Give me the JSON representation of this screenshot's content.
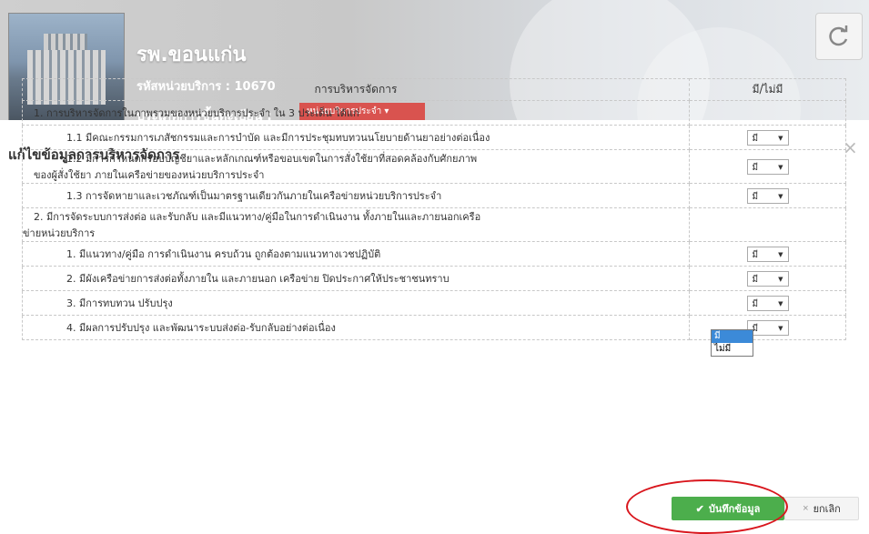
{
  "header": {
    "hospital_name": "รพ.ขอนแก่น",
    "code_label": "รหัสหน่วยบริการ : 10670",
    "type_label": "ประเภทการขึ้นทะเบียน :",
    "type_value": "หน่วยบริการประจำ ▾"
  },
  "modal": {
    "title": "แก้ไขข้อมูลการบริหารจัดการ",
    "close_label": "×"
  },
  "table": {
    "col_item": "การบริหารจัดการ",
    "col_status": "มี/ไม่มี",
    "rows": [
      {
        "text": "1. การบริหารจัดการในภาพรวมของหน่วยบริการประจำ ใน 3 ประเด็น ได้แก่",
        "value": ""
      },
      {
        "text": "1.1 มีคณะกรรมการเภสัชกรรมและการบำบัด และมีการประชุมทบทวนนโยบายด้านยาอย่างต่อเนื่อง",
        "value": "มี"
      },
      {
        "text": "1.2 มีการกำหนดกรอบบัญชียาและหลักเกณฑ์หรือขอบเขตในการสั่งใช้ยาที่สอดคล้องกับศักยภาพ",
        "text2": "ของผู้สั่งใช้ยา ภายในเครือข่ายของหน่วยบริการประจำ",
        "value": "มี"
      },
      {
        "text": "1.3 การจัดหายาและเวชภัณฑ์เป็นมาตรฐานเดียวกันภายในเครือข่ายหน่วยบริการประจำ",
        "value": "มี"
      },
      {
        "text": "2. มีการจัดระบบการส่งต่อ และรับกลับ และมีแนวทาง/คู่มือในการดำเนินงาน ทั้งภายในและภายนอกเครือ",
        "text2": "ข่ายหน่วยบริการ",
        "value": ""
      },
      {
        "text": "1. มีแนวทาง/คู่มือ การดำเนินงาน ครบถ้วน ถูกต้องตามแนวทางเวชปฏิบัติ",
        "value": "มี"
      },
      {
        "text": "2. มีผังเครือข่ายการส่งต่อทั้งภายใน และภายนอก เครือข่าย ปิดประกาศให้ประชาชนทราบ",
        "value": "มี"
      },
      {
        "text": "3. มีการทบทวน ปรับปรุง",
        "value": "มี"
      },
      {
        "text": "4. มีผลการปรับปรุง และพัฒนาระบบส่งต่อ-รับกลับอย่างต่อเนื่อง",
        "value": "มี"
      }
    ]
  },
  "dropdown": {
    "options": [
      "มี",
      "ไม่มี"
    ],
    "highlighted": "มี"
  },
  "buttons": {
    "save_label": "บันทึกข้อมูล",
    "save_icon": "check-icon",
    "cancel_label": "ยกเลิก",
    "cancel_icon": "close-icon"
  },
  "colors": {
    "save": "#4cae4c",
    "badge": "#d9534f",
    "highlight_ring": "#d9161d"
  }
}
